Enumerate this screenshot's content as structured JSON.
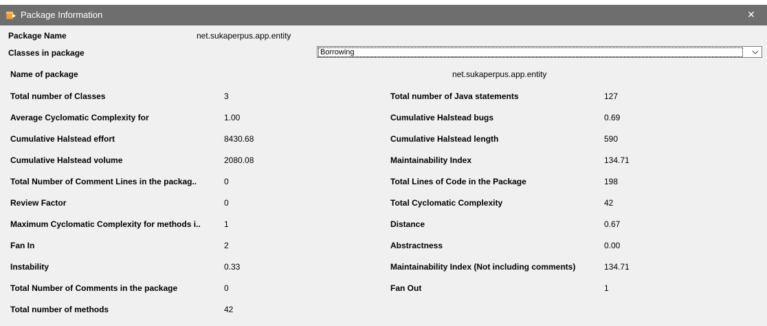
{
  "window": {
    "title": "Package Information",
    "close_glyph": "✕"
  },
  "header": {
    "package_name_label": "Package Name",
    "package_name_value": "net.sukaperpus.app.entity",
    "classes_label": "Classes in package",
    "classes_selected": "Borrowing",
    "name_of_package_label": "Name of package",
    "name_of_package_value": "net.sukaperpus.app.entity"
  },
  "left_metrics": [
    {
      "label": "Total number of Classes",
      "value": "3"
    },
    {
      "label": "Average Cyclomatic Complexity for",
      "value": "1.00"
    },
    {
      "label": "Cumulative Halstead effort",
      "value": "8430.68"
    },
    {
      "label": "Cumulative Halstead volume",
      "value": "2080.08"
    },
    {
      "label": "Total Number of Comment Lines in the packag..",
      "value": "0"
    },
    {
      "label": "Review Factor",
      "value": "0"
    },
    {
      "label": "Maximum Cyclomatic Complexity for methods i..",
      "value": "1"
    },
    {
      "label": "Fan In",
      "value": "2"
    },
    {
      "label": "Instability",
      "value": "0.33"
    },
    {
      "label": "Total Number of Comments in the package",
      "value": "0"
    },
    {
      "label": "Total number of methods",
      "value": "42"
    }
  ],
  "right_metrics": [
    {
      "label": "Total number of Java statements",
      "value": "127"
    },
    {
      "label": "Cumulative Halstead bugs",
      "value": "0.69"
    },
    {
      "label": "Cumulative Halstead length",
      "value": "590"
    },
    {
      "label": "Maintainability Index",
      "value": "134.71"
    },
    {
      "label": "Total Lines of Code in the Package",
      "value": "198"
    },
    {
      "label": "Total Cyclomatic Complexity",
      "value": "42"
    },
    {
      "label": "Distance",
      "value": "0.67"
    },
    {
      "label": "Abstractness",
      "value": "0.00"
    },
    {
      "label": "Maintainability Index (Not including comments)",
      "value": "134.71"
    },
    {
      "label": "Fan Out",
      "value": "1"
    }
  ]
}
